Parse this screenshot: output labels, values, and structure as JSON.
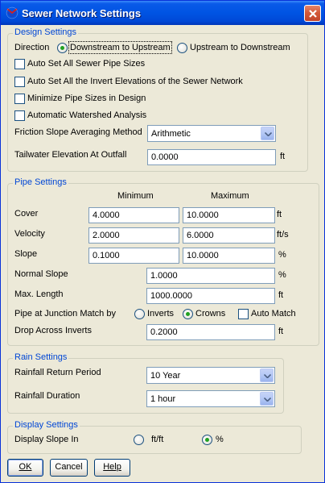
{
  "window": {
    "title": "Sewer Network Settings"
  },
  "design": {
    "group_title": "Design Settings",
    "direction_label": "Direction",
    "dir_option_1": "Downstream to Upstream",
    "dir_option_2": "Upstream to Downstream",
    "dir_selected": "Downstream to Upstream",
    "auto_set_sizes": "Auto Set All Sewer Pipe Sizes",
    "auto_set_inverts": "Auto Set All the Invert Elevations of the Sewer Network",
    "minimize_sizes": "Minimize Pipe Sizes in Design",
    "auto_watershed": "Automatic Watershed Analysis",
    "friction_label": "Friction Slope Averaging Method",
    "friction_value": "Arithmetic",
    "tailwater_label": "Tailwater Elevation At Outfall",
    "tailwater_value": "0.0000",
    "tailwater_unit": "ft"
  },
  "pipe": {
    "group_title": "Pipe Settings",
    "col_min": "Minimum",
    "col_max": "Maximum",
    "cover_label": "Cover",
    "cover_min": "4.0000",
    "cover_max": "10.0000",
    "cover_unit": "ft",
    "velocity_label": "Velocity",
    "velocity_min": "2.0000",
    "velocity_max": "6.0000",
    "velocity_unit": "ft/s",
    "slope_label": "Slope",
    "slope_min": "0.1000",
    "slope_max": "10.0000",
    "slope_unit": "%",
    "normal_slope_label": "Normal Slope",
    "normal_slope_value": "1.0000",
    "normal_slope_unit": "%",
    "max_length_label": "Max. Length",
    "max_length_value": "1000.0000",
    "max_length_unit": "ft",
    "junction_label": "Pipe at Junction Match by",
    "junction_opt_inverts": "Inverts",
    "junction_opt_crowns": "Crowns",
    "junction_selected": "Crowns",
    "auto_match": "Auto Match",
    "drop_label": "Drop Across Inverts",
    "drop_value": "0.2000",
    "drop_unit": "ft"
  },
  "rain": {
    "group_title": "Rain Settings",
    "return_label": "Rainfall Return Period",
    "return_value": "10 Year",
    "duration_label": "Rainfall Duration",
    "duration_value": "1 hour"
  },
  "display": {
    "group_title": "Display Settings",
    "slope_in_label": "Display Slope In",
    "opt_ftft": "ft/ft",
    "opt_pct": "%",
    "selected": "%"
  },
  "buttons": {
    "ok": "OK",
    "cancel": "Cancel",
    "help": "Help"
  },
  "colors": {
    "title_bar": "#0054e3",
    "group_title": "#0046d5",
    "radio_dot": "#21a121",
    "close_button": "#d45a3a"
  }
}
